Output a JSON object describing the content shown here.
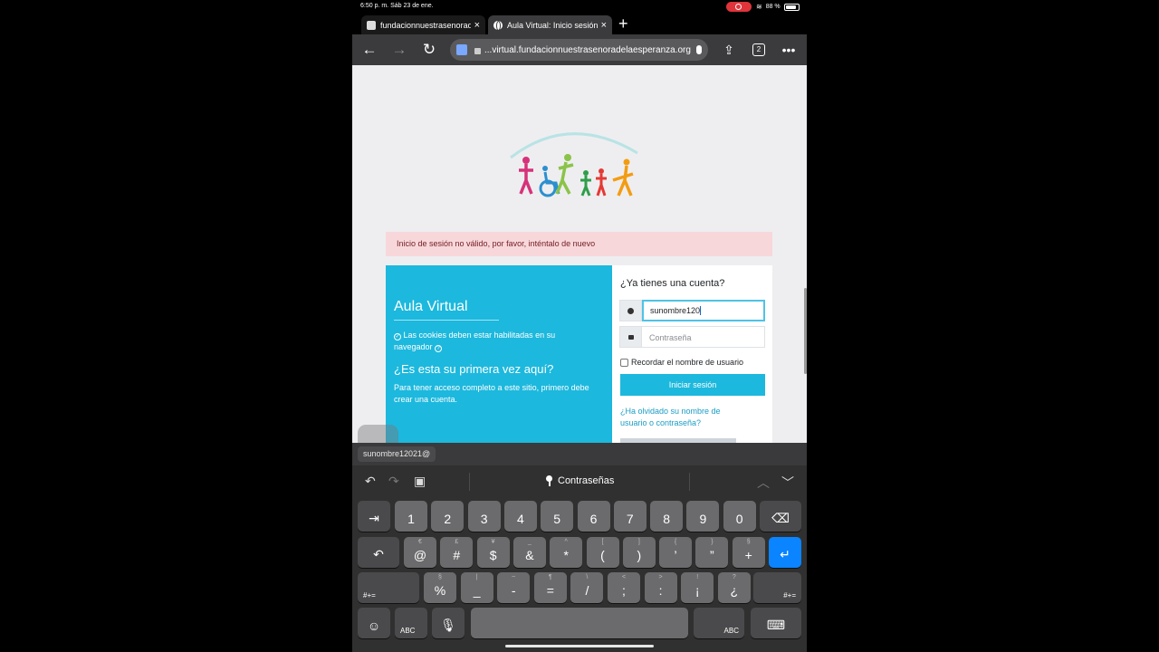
{
  "status_bar": {
    "time": "6:50 p. m.   Sáb 23 de ene.",
    "battery": "88 %",
    "battery_level": 0.88
  },
  "tabs": [
    {
      "title": "fundacionnuestrasenorad"
    },
    {
      "title": "Aula Virtual: Inicio sesión"
    }
  ],
  "toolbar": {
    "url": "...virtual.fundacionnuestrasenoradelaesperanza.org",
    "tab_count": "2"
  },
  "page": {
    "error_message": "Inicio de sesión no válido, por favor, inténtalo de nuevo",
    "left_panel": {
      "title": "Aula Virtual",
      "cookies_notice": "Las cookies deben estar habilitadas en su navegador",
      "first_time_heading": "¿Es esta su primera vez aquí?",
      "first_time_text": "Para tener acceso completo a este sitio, primero debe crear una cuenta."
    },
    "right_panel": {
      "heading": "¿Ya tienes una cuenta?",
      "username_value": "sunombre120",
      "password_placeholder": "Contraseña",
      "remember_label": "Recordar el nombre de usuario",
      "login_button": "Iniciar sesión",
      "forgot_link": "¿Ha olvidado su nombre de usuario o contraseña?"
    }
  },
  "autofill_suggestion": "sunombre12021@",
  "keyboard": {
    "passwords_label": "Contraseñas",
    "row1": [
      {
        "main": "1"
      },
      {
        "main": "2"
      },
      {
        "main": "3"
      },
      {
        "main": "4"
      },
      {
        "main": "5"
      },
      {
        "main": "6"
      },
      {
        "main": "7"
      },
      {
        "main": "8"
      },
      {
        "main": "9"
      },
      {
        "main": "0"
      }
    ],
    "row2": [
      {
        "main": "@",
        "alt": "€"
      },
      {
        "main": "#",
        "alt": "£"
      },
      {
        "main": "$",
        "alt": "¥"
      },
      {
        "main": "&",
        "alt": "_"
      },
      {
        "main": "*",
        "alt": "^"
      },
      {
        "main": "(",
        "alt": "["
      },
      {
        "main": ")",
        "alt": "]"
      },
      {
        "main": "’",
        "alt": "{"
      },
      {
        "main": "”",
        "alt": "}"
      },
      {
        "main": "+",
        "alt": "§"
      }
    ],
    "row3": [
      {
        "main": "%",
        "alt": "§"
      },
      {
        "main": "_",
        "alt": "|"
      },
      {
        "main": "-",
        "alt": "~"
      },
      {
        "main": "=",
        "alt": "¶"
      },
      {
        "main": "/",
        "alt": "\\"
      },
      {
        "main": ";",
        "alt": "<"
      },
      {
        "main": ":",
        "alt": ">"
      },
      {
        "main": "¡",
        "alt": "!"
      },
      {
        "main": "¿",
        "alt": "?"
      }
    ],
    "symbols_label": "#+=",
    "abc_label": "ABC"
  }
}
